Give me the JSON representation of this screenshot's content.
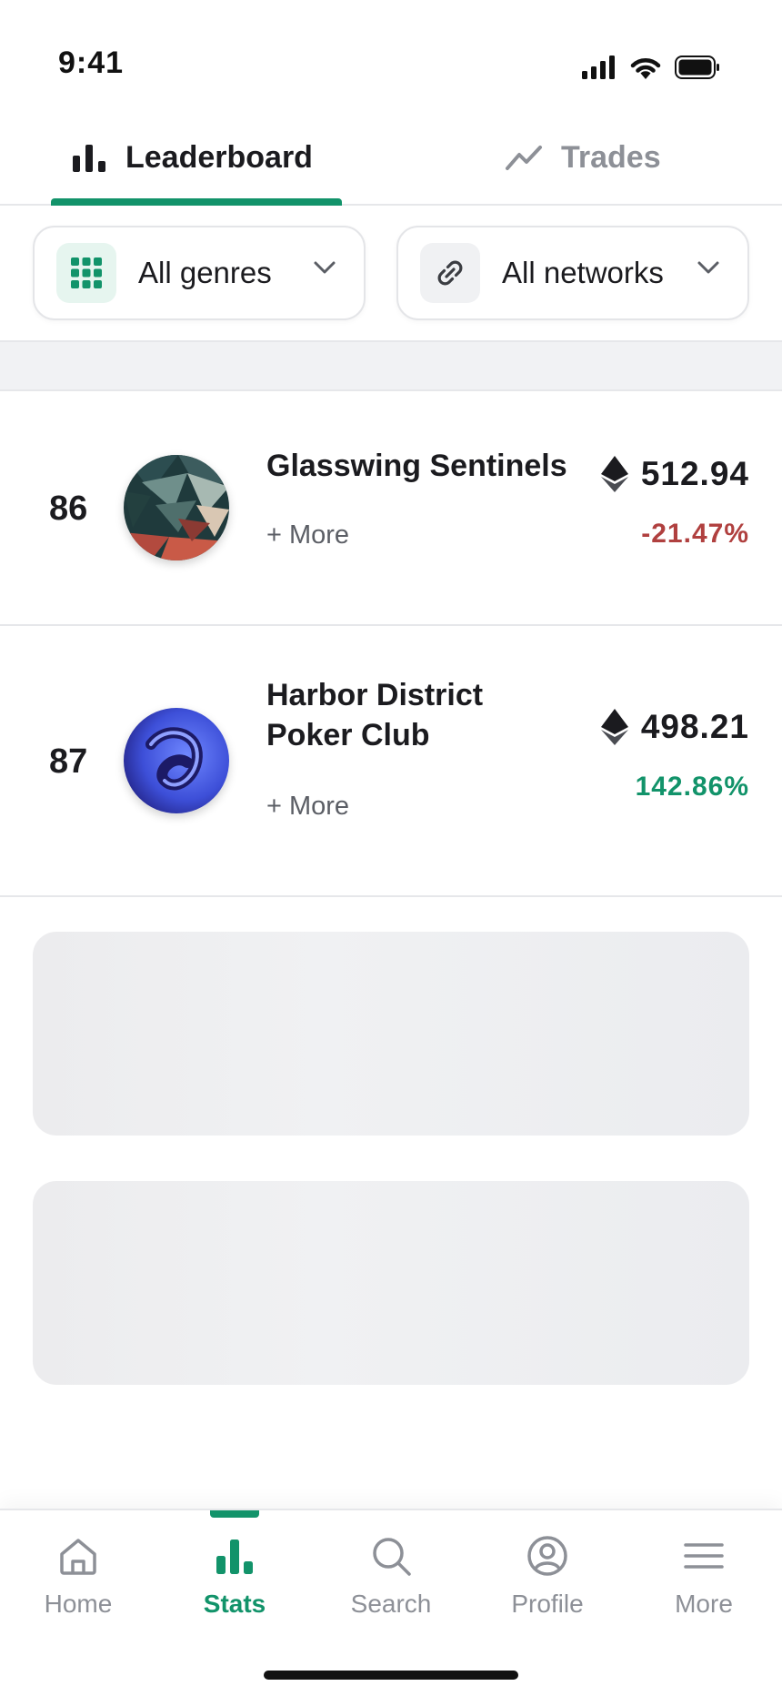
{
  "status_bar": {
    "time": "9:41"
  },
  "tabs": [
    {
      "label": "Leaderboard",
      "icon": "bar-chart-icon",
      "active": true
    },
    {
      "label": "Trades",
      "icon": "trend-line-icon",
      "active": false
    }
  ],
  "filters": {
    "genre": {
      "label": "All genres",
      "icon": "grid-icon"
    },
    "network": {
      "label": "All networks",
      "icon": "link-icon"
    }
  },
  "rows": [
    {
      "rank": "86",
      "name_line1": "Glasswing Sentinels",
      "name_line2": "",
      "more": "+ More",
      "price": "512.94",
      "change": "-21.47%",
      "change_color": "#b0403f",
      "currency_icon": "ethereum-icon"
    },
    {
      "rank": "87",
      "name_line1": "Harbor District",
      "name_line2": "Poker Club",
      "more": "+ More",
      "price": "498.21",
      "change": "142.86%",
      "change_color": "#12936a",
      "currency_icon": "ethereum-icon"
    }
  ],
  "bottom_nav": [
    {
      "label": "Home",
      "icon": "home-icon"
    },
    {
      "label": "Stats",
      "icon": "bar-chart-icon",
      "active": true
    },
    {
      "label": "Search",
      "icon": "search-icon"
    },
    {
      "label": "Profile",
      "icon": "user-circle-icon"
    },
    {
      "label": "More",
      "icon": "menu-icon"
    }
  ],
  "colors": {
    "accent": "#12936a",
    "negative": "#b0403f",
    "positive": "#12936a"
  }
}
